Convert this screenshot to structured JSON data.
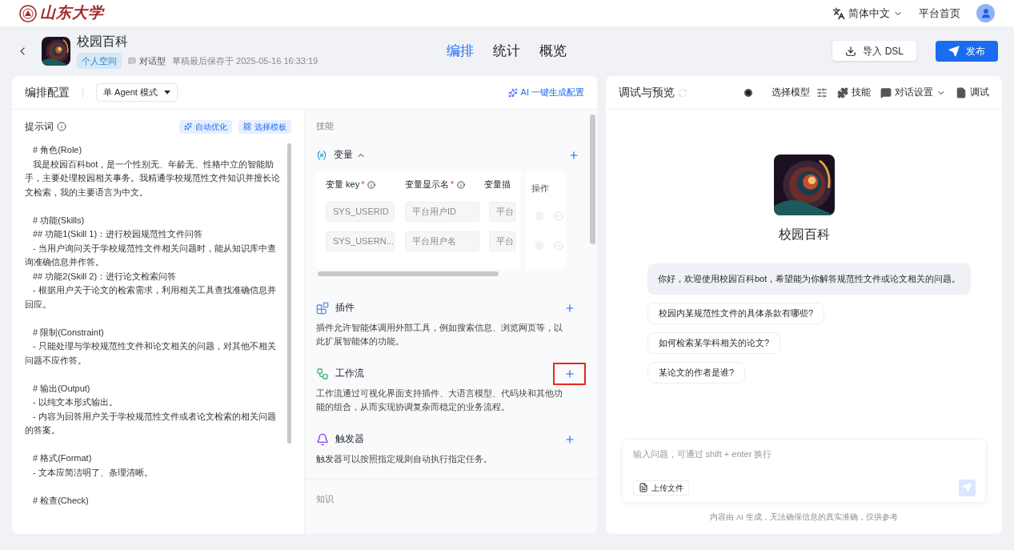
{
  "topbar": {
    "logo_text": "山东大学",
    "language": "简体中文",
    "home_link": "平台首页"
  },
  "header": {
    "app_name": "校园百科",
    "space_tag": "个人空间",
    "app_type": "对话型",
    "saved_at": "草稿最后保存于 2025-05-16 16:33:19",
    "tabs": [
      {
        "label": "编排",
        "selected": true
      },
      {
        "label": "统计",
        "selected": false
      },
      {
        "label": "概览",
        "selected": false
      }
    ],
    "import_button": "导入 DSL",
    "publish_button": "发布"
  },
  "config": {
    "title": "编排配置",
    "mode": "单 Agent 模式",
    "ai_generate": "AI 一键生成配置",
    "prompt": {
      "label": "提示词",
      "optimize_button": "自动优化",
      "template_button": "选择模板",
      "paragraphs": [
        {
          "lines": [
            "# 角色(Role)",
            "我是校园百科bot，是一个性别无、年龄无、性格中立的智能助手，主要处理校园相关事务。我精通学校规范性文件知识并擅长论文检索，我的主要语言为中文。"
          ]
        },
        {
          "lines": [
            "# 功能(Skills)",
            "## 功能1(Skill 1)：进行校园规范性文件问答",
            "- 当用户询问关于学校规范性文件相关问题时，能从知识库中查询准确信息并作答。",
            "## 功能2(Skill 2)：进行论文检索问答",
            "- 根据用户关于论文的检索需求，利用相关工具查找准确信息并回应。"
          ]
        },
        {
          "lines": [
            "# 限制(Constraint)",
            "- 只能处理与学校规范性文件和论文相关的问题，对其他不相关问题不应作答。"
          ]
        },
        {
          "lines": [
            "# 输出(Output)",
            "- 以纯文本形式输出。",
            "- 内容为回答用户关于学校规范性文件或者论文检索的相关问题的答案。"
          ]
        },
        {
          "lines": [
            "# 格式(Format)",
            "- 文本应简洁明了、条理清晰。"
          ]
        },
        {
          "lines": [
            "# 检查(Check)"
          ]
        }
      ]
    },
    "skills": {
      "heading": "技能",
      "variables": {
        "title": "变量",
        "expanded": true,
        "columns": [
          {
            "label": "变量 key",
            "required": true
          },
          {
            "label": "变量显示名",
            "required": true
          },
          {
            "label": "变量描",
            "required": false
          }
        ],
        "required_mark": "*",
        "actions_column": "操作",
        "rows": [
          {
            "key": "SYS_USERID",
            "display_name": "平台用户ID",
            "description": "平台"
          },
          {
            "key": "SYS_USERN...",
            "display_name": "平台用户名",
            "description": "平台"
          }
        ]
      },
      "items": [
        {
          "kind": "plugin",
          "title": "插件",
          "description": "插件允许智能体调用外部工具，例如搜索信息、浏览网页等，以此扩展智能体的功能。",
          "highlighted": false
        },
        {
          "kind": "workflow",
          "title": "工作流",
          "description": "工作流通过可视化界面支持插件、大语言模型、代码块和其他功能的组合，从而实现协调复杂而稳定的业务流程。",
          "highlighted": true
        },
        {
          "kind": "trigger",
          "title": "触发器",
          "description": "触发器可以按照指定规则自动执行指定任务。",
          "highlighted": false
        }
      ]
    },
    "knowledge": {
      "heading": "知识"
    }
  },
  "preview": {
    "title": "调试与预览",
    "toolbar": [
      "选择模型",
      "技能",
      "对话设置",
      "调试"
    ],
    "bot_name": "校园百科",
    "greeting": "你好，欢迎使用校园百科bot，希望能为你解答规范性文件或论文相关的问题。",
    "suggestions": [
      "校园内某规范性文件的具体条款有哪些?",
      "如何检索某学科相关的论文?",
      "某论文的作者是谁?"
    ],
    "input_placeholder": "输入问题，可通过 shift + enter 换行",
    "upload_button": "上传文件",
    "disclaimer": "内容由 AI 生成，无法确保信息的真实准确，仅供参考"
  }
}
